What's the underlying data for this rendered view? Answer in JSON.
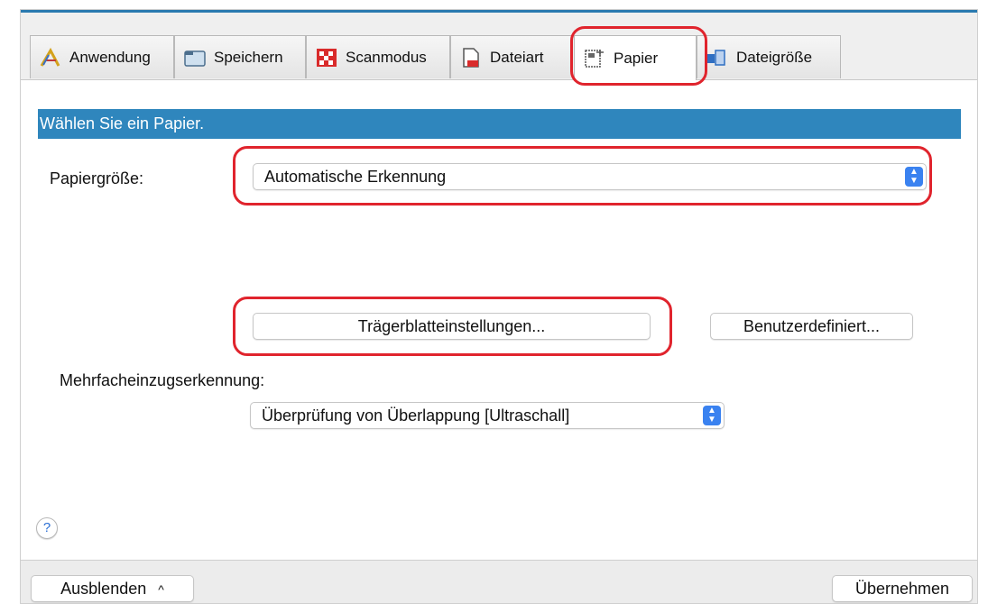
{
  "tabs": [
    {
      "label": "Anwendung",
      "icon": "application-icon"
    },
    {
      "label": "Speichern",
      "icon": "folder-icon"
    },
    {
      "label": "Scanmodus",
      "icon": "scan-mode-icon"
    },
    {
      "label": "Dateiart",
      "icon": "file-type-icon"
    },
    {
      "label": "Papier",
      "icon": "paper-icon",
      "active": true
    },
    {
      "label": "Dateigröße",
      "icon": "file-size-icon"
    }
  ],
  "header": {
    "title": "Wählen Sie ein Papier."
  },
  "paper": {
    "size_label": "Papiergröße:",
    "size_value": "Automatische Erkennung",
    "carrier_button": "Trägerblatteinstellungen...",
    "custom_button": "Benutzerdefiniert...",
    "multifeed_label": "Mehrfacheinzugserkennung:",
    "multifeed_value": "Überprüfung von Überlappung [Ultraschall]"
  },
  "help": {
    "symbol": "?"
  },
  "footer": {
    "hide_button": "Ausblenden",
    "hide_chevron": "^",
    "apply_button": "Übernehmen"
  },
  "colors": {
    "accent_band": "#2f86bd",
    "highlight_ring": "#e0242d",
    "stepper": "#3a82f0"
  }
}
